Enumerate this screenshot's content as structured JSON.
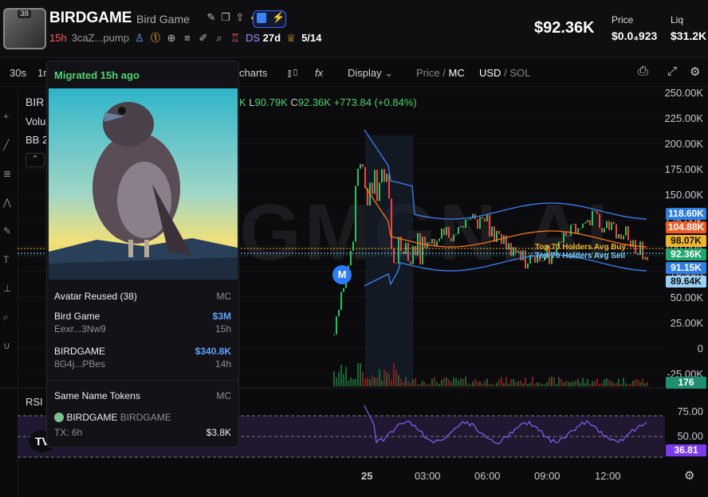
{
  "header": {
    "avatar_count": "38",
    "token_symbol": "BIRDGAME",
    "token_name": "Bird Game",
    "age": "15h",
    "address": "3caZ...pump",
    "ds_age": "27d",
    "ds_label": "DS",
    "score": "5/14",
    "price_main": "$92.36K",
    "price_label": "Price",
    "price_value": "$0.0₄923",
    "liq_label": "Liq",
    "liq_value": "$31.2K"
  },
  "toolbar": {
    "interval_30s": "30s",
    "interval_1m": "1m",
    "charts": "charts",
    "display": "Display",
    "price": "Price",
    "mc": "MC",
    "usd": "USD",
    "sol": "SOL"
  },
  "chart": {
    "symbol": "BIR",
    "volume_label": "Volu",
    "bb_label": "BB 2",
    "ohlc_tail_k": "K",
    "ohlc_l_label": "L",
    "ohlc_l": "90.79K",
    "ohlc_c_label": "C",
    "ohlc_c": "92.36K",
    "ohlc_change": "+773.84 (+0.84%)",
    "watermark": "GMGN.AI",
    "holders_buy": "Top 70 Holders Avg Buy",
    "holders_sell": "Top 70 Holders Avg Sell",
    "migrate_badge": "M",
    "rsi_label": "RSI",
    "tv_logo": "TV"
  },
  "price_axis": [
    "250.00K",
    "225.00K",
    "200.00K",
    "175.00K",
    "150.00K",
    "125.00K",
    "100.00K",
    "75.00K",
    "50.00K",
    "25.00K",
    "0",
    "-25.00K"
  ],
  "price_tags": [
    {
      "value": "118.60K",
      "color": "#2f7de1"
    },
    {
      "value": "104.88K",
      "color": "#f05a28"
    },
    {
      "value": "98.07K",
      "color": "#f0b429"
    },
    {
      "value": "92.36K",
      "color": "#22a66e"
    },
    {
      "value": "91.15K",
      "color": "#2f7de1"
    },
    {
      "value": "89.64K",
      "color": "#9ad0f5"
    },
    {
      "value": "176",
      "color": "#1f8f72"
    }
  ],
  "rsi_axis": [
    "75.00",
    "50.00"
  ],
  "rsi_tag": "36.81",
  "time_axis": [
    "25",
    "03:00",
    "06:00",
    "09:00",
    "12:00"
  ],
  "colors": {
    "accent_green": "#4fd470",
    "accent_blue": "#60a5fa",
    "age_red": "#ff5a5a",
    "gold": "#f0b429"
  },
  "popup": {
    "title": "Migrated 15h ago",
    "reused_label": "Avatar Reused (38)",
    "mc_label": "MC",
    "items": [
      {
        "name": "Bird Game",
        "addr": "Eexr...3Nw9",
        "mc": "$3M",
        "age": "15h"
      },
      {
        "name": "BIRDGAME",
        "addr": "8G4j...PBes",
        "mc": "$340.8K",
        "age": "14h"
      }
    ],
    "same_name_label": "Same Name Tokens",
    "same_name_mc": "MC",
    "same_token": {
      "name": "BIRDGAME",
      "symbol": "BIRDGAME",
      "tx": "TX: 6h",
      "mc": "$3.8K"
    }
  }
}
